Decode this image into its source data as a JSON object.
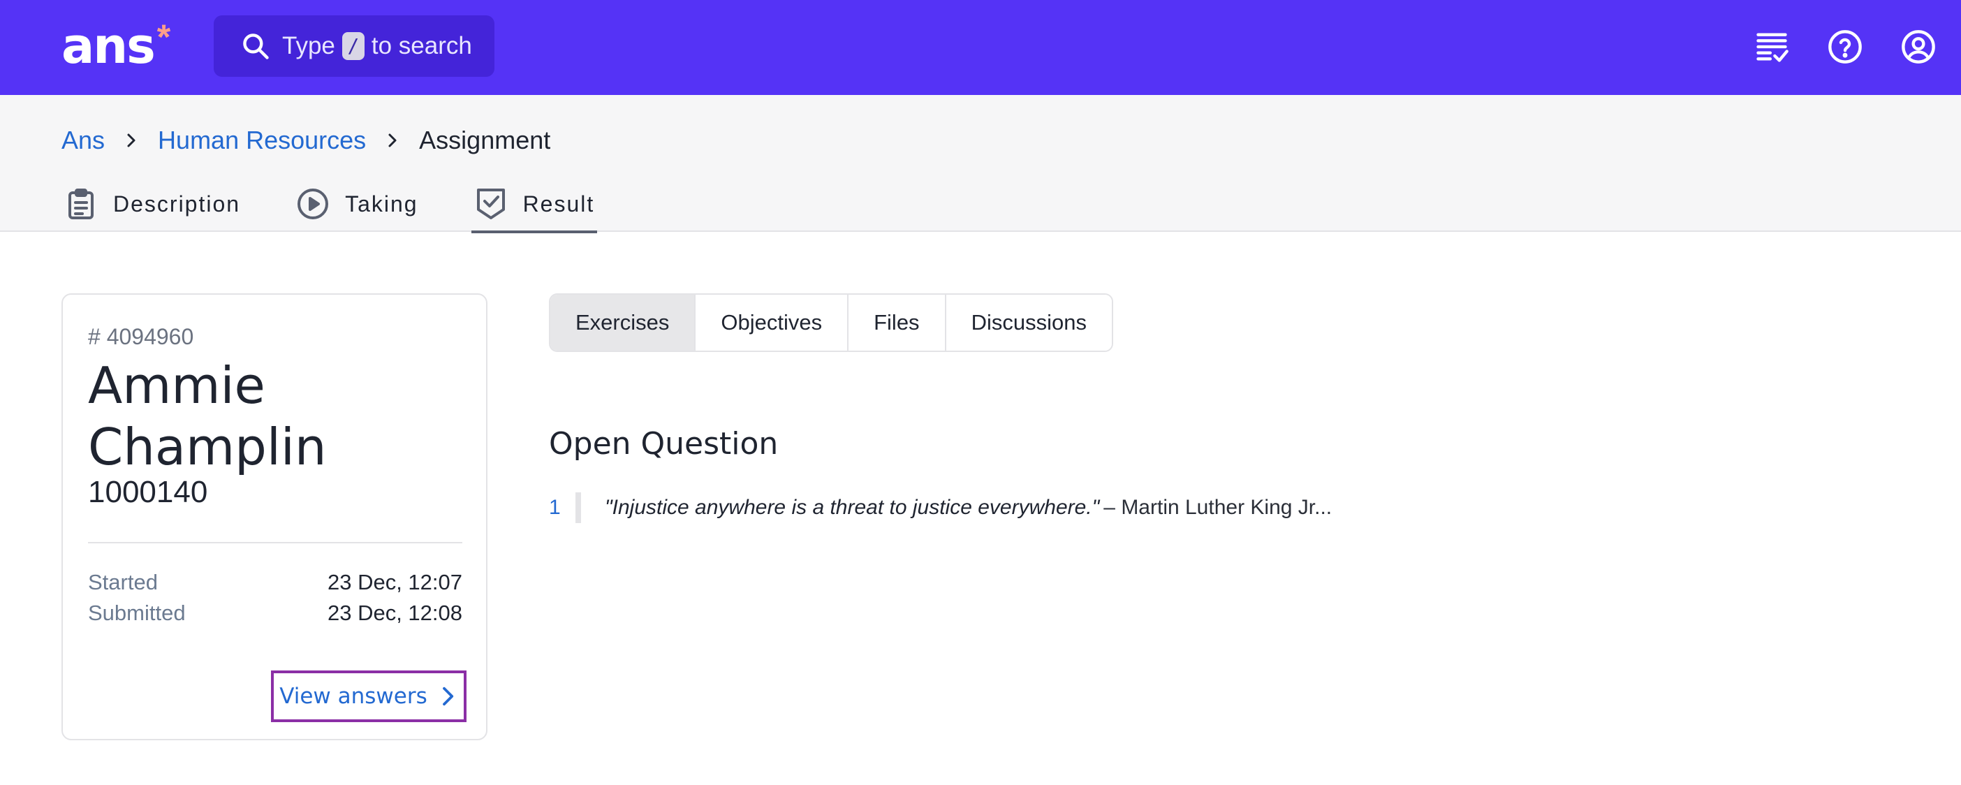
{
  "header": {
    "logo_text": "ans",
    "logo_mark": "*",
    "search": {
      "prefix": "Type",
      "key": "/",
      "suffix": "to search"
    },
    "icons": [
      "task-list-icon",
      "help-icon",
      "account-icon"
    ]
  },
  "breadcrumb": {
    "items": [
      "Ans",
      "Human Resources"
    ],
    "current": "Assignment"
  },
  "nav": {
    "items": [
      {
        "label": "Description",
        "icon": "clipboard-icon"
      },
      {
        "label": "Taking",
        "icon": "play-circle-icon"
      },
      {
        "label": "Result",
        "icon": "shield-check-icon",
        "active": true
      }
    ]
  },
  "student": {
    "id": "# 4094960",
    "name": "Ammie Champlin",
    "number": "1000140",
    "started_label": "Started",
    "started_value": "23 Dec, 12:07",
    "submitted_label": "Submitted",
    "submitted_value": "23 Dec, 12:08",
    "view_answers_label": "View answers"
  },
  "tabs": {
    "items": [
      "Exercises",
      "Objectives",
      "Files",
      "Discussions"
    ],
    "active_index": 0
  },
  "question": {
    "title": "Open Question",
    "number": "1",
    "quote": "\"Injustice anywhere is a threat to justice everywhere.\"",
    "author": "– Martin Luther King Jr..."
  },
  "colors": {
    "brand": "#5533f6",
    "link": "#2369d1",
    "highlight_border": "#8b2fa6",
    "logo_mark": "#ff9f8a"
  }
}
